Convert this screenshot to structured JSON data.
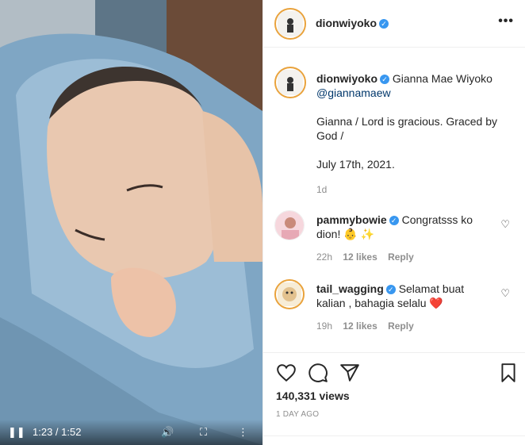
{
  "video": {
    "time": "1:23 / 1:52",
    "pause_icon": "❚❚",
    "volume_icon": "🔊",
    "fullscreen_icon": "⛶",
    "more_icon": "⋮"
  },
  "post": {
    "username": "dionwiyoko",
    "verified_mark": "✓",
    "more_icon": "•••",
    "caption": {
      "username": "dionwiyoko",
      "name": "Gianna Mae Wiyoko",
      "mention": "@giannamaew",
      "line1": "Gianna / Lord is gracious. Graced by God /",
      "line2": "July 17th, 2021.",
      "age": "1d"
    },
    "comments": [
      {
        "username": "pammybowie",
        "text": "Congratsss ko dion! 👶 ✨",
        "age": "22h",
        "likes": "12 likes",
        "reply": "Reply",
        "like_icon": "♡"
      },
      {
        "username": "tail_wagging",
        "text": "Selamat buat kalian , bahagia selalu ❤️",
        "age": "19h",
        "likes": "12 likes",
        "reply": "Reply",
        "like_icon": "♡"
      }
    ],
    "views": "140,331 views",
    "posted": "1 DAY AGO"
  },
  "colors": {
    "accent_blue": "#3897f0",
    "mention": "#00376b",
    "muted": "#8e8e8e",
    "blanket": "#7fa6c4"
  }
}
